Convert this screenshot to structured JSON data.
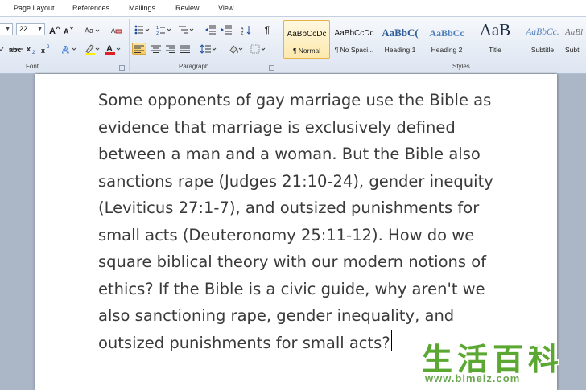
{
  "tabs": [
    "Page Layout",
    "References",
    "Mailings",
    "Review",
    "View"
  ],
  "font_group": {
    "label": "Font",
    "font_size": "22"
  },
  "paragraph_group": {
    "label": "Paragraph"
  },
  "styles_group": {
    "label": "Styles",
    "items": [
      {
        "preview": "AaBbCcDc",
        "name": "¶ Normal",
        "selected": true,
        "color": "#111111"
      },
      {
        "preview": "AaBbCcDc",
        "name": "¶ No Spaci...",
        "selected": false,
        "color": "#111111"
      },
      {
        "preview": "AaBbC(",
        "name": "Heading 1",
        "selected": false,
        "color": "#2f5d96"
      },
      {
        "preview": "AaBbCc",
        "name": "Heading 2",
        "selected": false,
        "color": "#4f81bd"
      },
      {
        "preview": "AaB",
        "name": "Title",
        "selected": false,
        "color": "#1f2f48"
      },
      {
        "preview": "AaBbCc.",
        "name": "Subtitle",
        "selected": false,
        "color": "#4f81bd"
      },
      {
        "preview": "AaBl",
        "name": "Subtl",
        "selected": false,
        "color": "#6f6f6f"
      }
    ]
  },
  "document": {
    "lines": [
      "Some opponents of gay marriage use the Bible as",
      "evidence that marriage is exclusively defined",
      "between a man and a woman. But the Bible also",
      "sanctions rape (Judges 21:10-24), gender inequity",
      "(Leviticus 27:1-7), and outsized punishments for",
      "small acts (Deuteronomy 25:11-12). How do we",
      "square biblical theory with our modern notions of",
      "ethics? If the Bible is a civic guide, why aren't we",
      "also sanctioning rape, gender inequality, and",
      "outsized punishments for small acts?"
    ]
  },
  "watermark": {
    "chars": "生活百科",
    "url": "www.bimeiz.com",
    "color": "#5aa832"
  }
}
